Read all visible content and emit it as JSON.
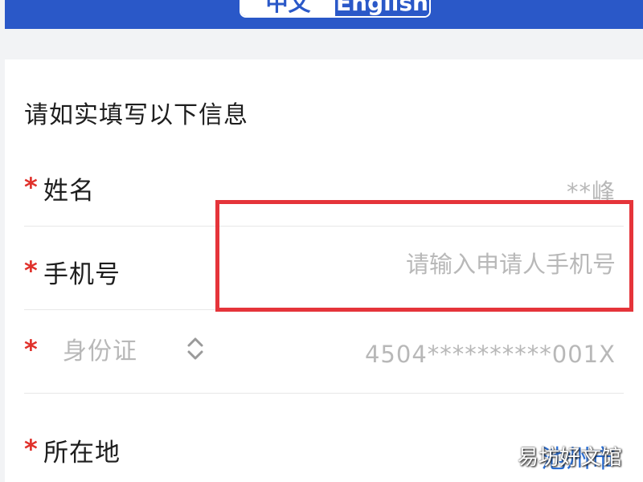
{
  "header": {
    "lang_zh": "中文",
    "lang_en": "English"
  },
  "form": {
    "intro": "请如实填写以下信息",
    "required_mark": "*",
    "name": {
      "label": "姓名",
      "value": "**峰"
    },
    "phone": {
      "label": "手机号",
      "placeholder": "请输入申请人手机号",
      "value": ""
    },
    "id_type": {
      "selected": "身份证",
      "value": "4504**********001X"
    },
    "location": {
      "label": "所在地",
      "value": "池州市"
    }
  },
  "watermark": "易坊好文馆",
  "colors": {
    "brand_blue": "#2a58c8",
    "required_red": "#e0312b",
    "highlight_red": "#e5343a",
    "link_blue": "#2a6fd6"
  }
}
